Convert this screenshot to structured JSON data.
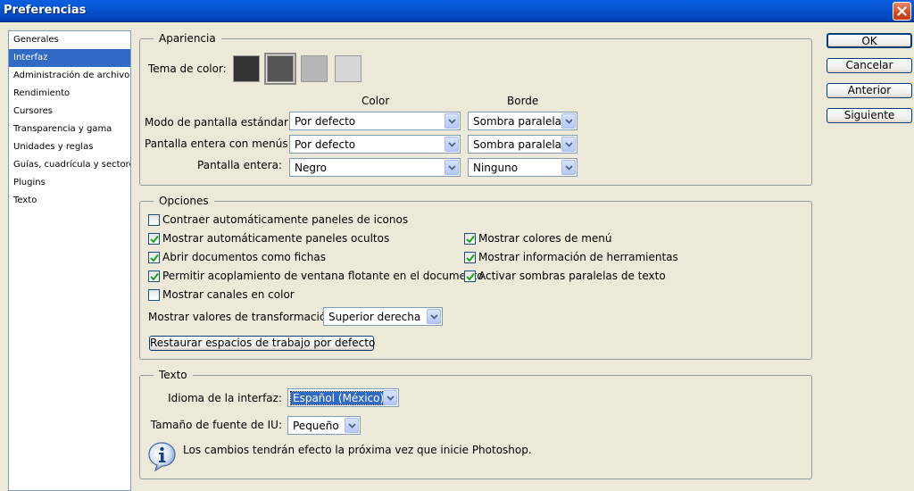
{
  "window": {
    "title": "Preferencias"
  },
  "sidebar": {
    "items": [
      {
        "label": "Generales",
        "selected": false
      },
      {
        "label": "Interfaz",
        "selected": true
      },
      {
        "label": "Administración de archivos",
        "selected": false
      },
      {
        "label": "Rendimiento",
        "selected": false
      },
      {
        "label": "Cursores",
        "selected": false
      },
      {
        "label": "Transparencia y gama",
        "selected": false
      },
      {
        "label": "Unidades y reglas",
        "selected": false
      },
      {
        "label": "Guías, cuadrícula y sectores",
        "selected": false
      },
      {
        "label": "Plugins",
        "selected": false
      },
      {
        "label": "Texto",
        "selected": false
      }
    ]
  },
  "apariencia": {
    "legend": "Apariencia",
    "color_theme_label": "Tema de color:",
    "swatches": [
      "#333333",
      "#555555",
      "#b6b6b6",
      "#d6d6d6"
    ],
    "color_header": "Color",
    "border_header": "Borde",
    "rows": [
      {
        "label": "Modo de pantalla estándar:",
        "color": "Por defecto",
        "border": "Sombra paralela"
      },
      {
        "label": "Pantalla entera con menús:",
        "color": "Por defecto",
        "border": "Sombra paralela"
      },
      {
        "label": "Pantalla entera:",
        "color": "Negro",
        "border": "Ninguno"
      }
    ]
  },
  "opciones": {
    "legend": "Opciones",
    "checks": [
      {
        "label": "Contraer automáticamente paneles de iconos",
        "checked": false
      },
      {
        "label": "Mostrar automáticamente paneles ocultos",
        "checked": true
      },
      {
        "label": "Abrir documentos como fichas",
        "checked": true
      },
      {
        "label": "Permitir acoplamiento de ventana flotante en el documento",
        "checked": true
      },
      {
        "label": "Mostrar canales en color",
        "checked": false
      },
      {
        "label": "Mostrar colores de menú",
        "checked": true
      },
      {
        "label": "Mostrar información de herramientas",
        "checked": true
      },
      {
        "label": "Activar sombras paralelas de texto",
        "checked": true
      }
    ],
    "transform_label": "Mostrar valores de transformación:",
    "transform_value": "Superior derecha",
    "restore_button": "Restaurar espacios de trabajo por defecto"
  },
  "texto": {
    "legend": "Texto",
    "language_label": "Idioma de la interfaz:",
    "language_value": "Español (México)",
    "font_size_label": "Tamaño de fuente de IU:",
    "font_size_value": "Pequeño",
    "info_message": "Los cambios tendrán efecto la próxima vez que inicie Photoshop."
  },
  "buttons": {
    "ok": "OK",
    "cancel": "Cancelar",
    "prev": "Anterior",
    "next": "Siguiente"
  }
}
